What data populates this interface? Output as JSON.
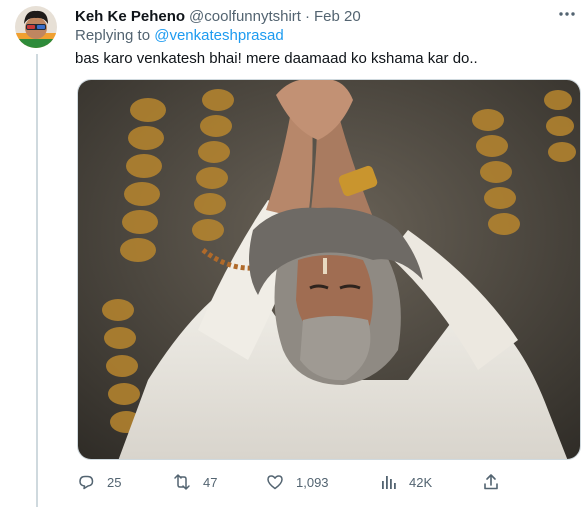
{
  "tweet": {
    "author_name": "Keh Ke Peheno",
    "author_handle": "@coolfunnytshirt",
    "separator": "·",
    "date": "Feb 20",
    "replying_to_prefix": "Replying to",
    "replying_to_handle": "@venkateshprasad",
    "text": "bas karo venkatesh bhai! mere daamaad ko kshama kar do.."
  },
  "actions": {
    "replies": "25",
    "retweets": "47",
    "likes": "1,093",
    "views": "42K"
  },
  "icons": {
    "avatar": "avatar-photo",
    "more": "more-icon",
    "reply": "reply-icon",
    "retweet": "retweet-icon",
    "like": "heart-icon",
    "views": "views-icon",
    "share": "share-icon"
  },
  "colors": {
    "text": "#0f1419",
    "secondary": "#536471",
    "link": "#1d9bf0",
    "divider": "#cfd9de"
  }
}
